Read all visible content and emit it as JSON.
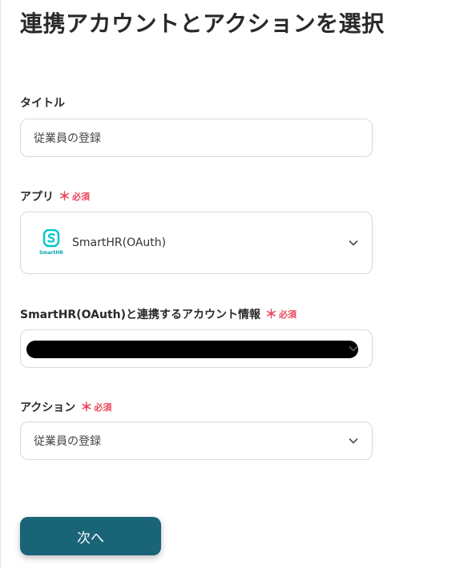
{
  "page": {
    "title": "連携アカウントとアクションを選択"
  },
  "fields": {
    "title": {
      "label": "タイトル",
      "value": "従業員の登録"
    },
    "app": {
      "label": "アプリ",
      "required_mark": "＊",
      "required_text": "必須",
      "icon_caption": "SmartHR",
      "value": "SmartHR(OAuth)"
    },
    "account": {
      "label": "SmartHR(OAuth)と連携するアカウント情報",
      "required_mark": "＊",
      "required_text": "必須"
    },
    "action": {
      "label": "アクション",
      "required_mark": "＊",
      "required_text": "必須",
      "value": "従業員の登録"
    }
  },
  "buttons": {
    "next_label": "次へ"
  },
  "colors": {
    "primary": "#1a6478",
    "required": "#e8475a",
    "app_icon": "#00c4cc"
  },
  "icons": {
    "select_arrow": "chevron-down-icon",
    "app": "smarthr-logo-icon"
  }
}
